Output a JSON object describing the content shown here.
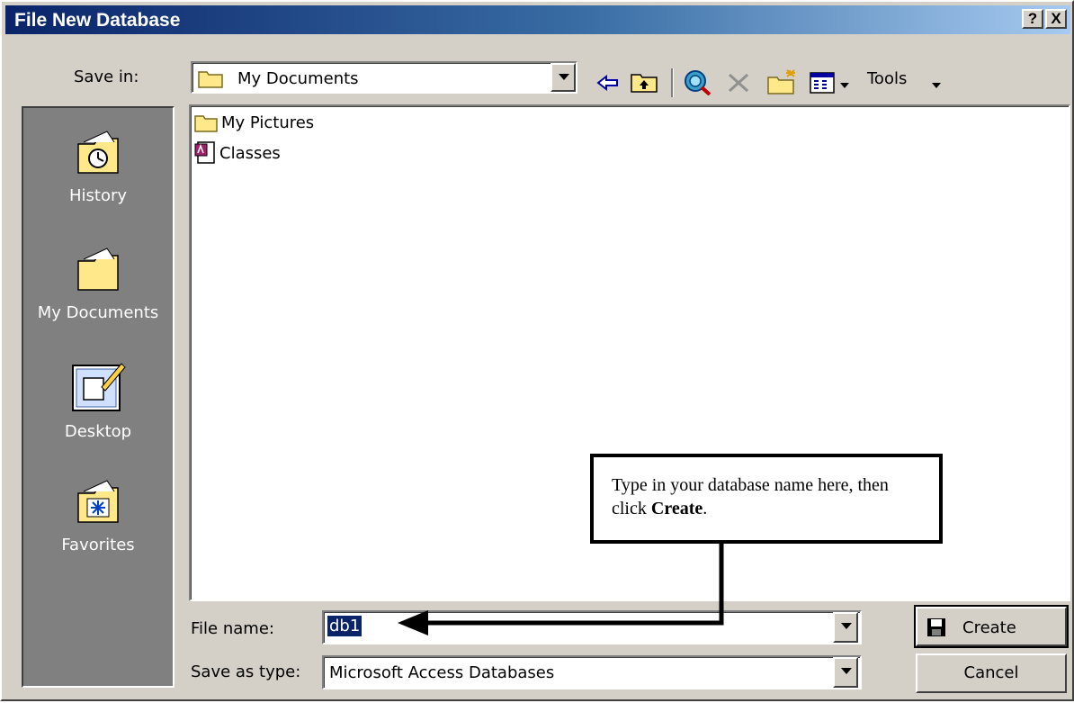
{
  "title": "File New Database",
  "title_buttons": {
    "help": "?",
    "close": "X"
  },
  "save_in": {
    "label": "Save in:",
    "value": "My Documents"
  },
  "toolbar": {
    "tools_label": "Tools"
  },
  "places": [
    {
      "label": "History",
      "icon": "history-icon"
    },
    {
      "label": "My Documents",
      "icon": "my-documents-icon"
    },
    {
      "label": "Desktop",
      "icon": "desktop-icon"
    },
    {
      "label": "Favorites",
      "icon": "favorites-icon"
    }
  ],
  "files": [
    {
      "name": "My Pictures",
      "icon": "folder-icon"
    },
    {
      "name": "Classes",
      "icon": "access-db-icon"
    }
  ],
  "file_name": {
    "label": "File name:",
    "value": "db1"
  },
  "save_as_type": {
    "label": "Save as type:",
    "value": "Microsoft Access Databases"
  },
  "buttons": {
    "create": "Create",
    "cancel": "Cancel"
  },
  "callout": {
    "text_before": "Type in your database name here, then click ",
    "bold": "Create",
    "text_after": "."
  },
  "colors": {
    "titlebar_start": "#0a246a",
    "dialog_bg": "#d4d0c8",
    "places_bg": "#808080",
    "selection": "#0a246a"
  }
}
